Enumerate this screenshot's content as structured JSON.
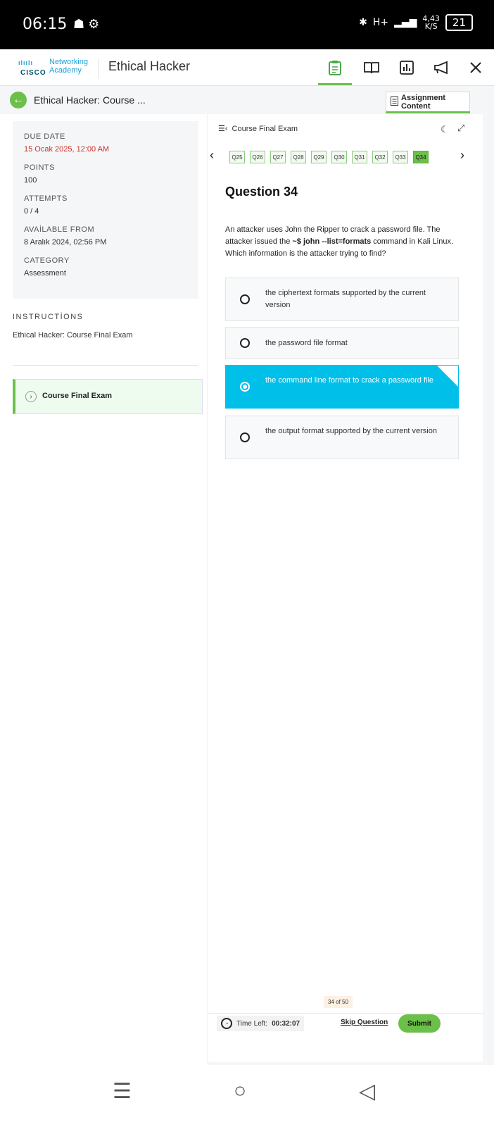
{
  "status": {
    "time": "06:15",
    "network": "H+",
    "speed_value": "4,43",
    "speed_unit": "K/S",
    "battery": "21"
  },
  "topnav": {
    "logo_networking": "Networking",
    "logo_academy": "Academy",
    "logo_cisco": "CISCO",
    "app_title": "Ethical Hacker"
  },
  "subbar": {
    "course_crumb": "Ethical Hacker: Course ...",
    "assignment_label": "Assignment Content"
  },
  "info": {
    "due_label": "DUE DATE",
    "due_value": "15 Ocak 2025, 12:00 AM",
    "points_label": "POINTS",
    "points_value": "100",
    "attempts_label": "ATTEMPTS",
    "attempts_value": "0 / 4",
    "available_label": "AVAİLABLE FROM",
    "available_value": "8 Aralık 2024, 02:56 PM",
    "category_label": "CATEGORY",
    "category_value": "Assessment"
  },
  "instructions": {
    "label": "INSTRUCTİONS",
    "text": "Ethical Hacker: Course Final Exam"
  },
  "lesson": {
    "label": "Course Final Exam"
  },
  "exam": {
    "header": "Course Final Exam",
    "question_chips": [
      "Q25",
      "Q26",
      "Q27",
      "Q28",
      "Q29",
      "Q30",
      "Q31",
      "Q32",
      "Q33",
      "Q34"
    ],
    "current_chip": "Q34",
    "question_title": "Question 34",
    "question_pre": "An attacker uses John the Ripper to crack a password file. The attacker issued the ",
    "question_cmd": "~$ john --list=formats",
    "question_post": " command in Kali Linux. Which information is the attacker trying to find?",
    "options": [
      {
        "text": "the ciphertext formats supported by the current version",
        "selected": false
      },
      {
        "text": "the password file format",
        "selected": false
      },
      {
        "text": "the command line format to crack a password file",
        "selected": true
      },
      {
        "text": "the output format supported by the current version",
        "selected": false
      }
    ],
    "counter": "34 of 50",
    "timer_label": "Time Left:",
    "timer_value": "00:32:07",
    "skip_label": "Skip Question",
    "submit_label": "Submit"
  },
  "colors": {
    "accent_green": "#6cc04a",
    "selected_blue": "#00bfe8",
    "due_red": "#c9312c"
  }
}
